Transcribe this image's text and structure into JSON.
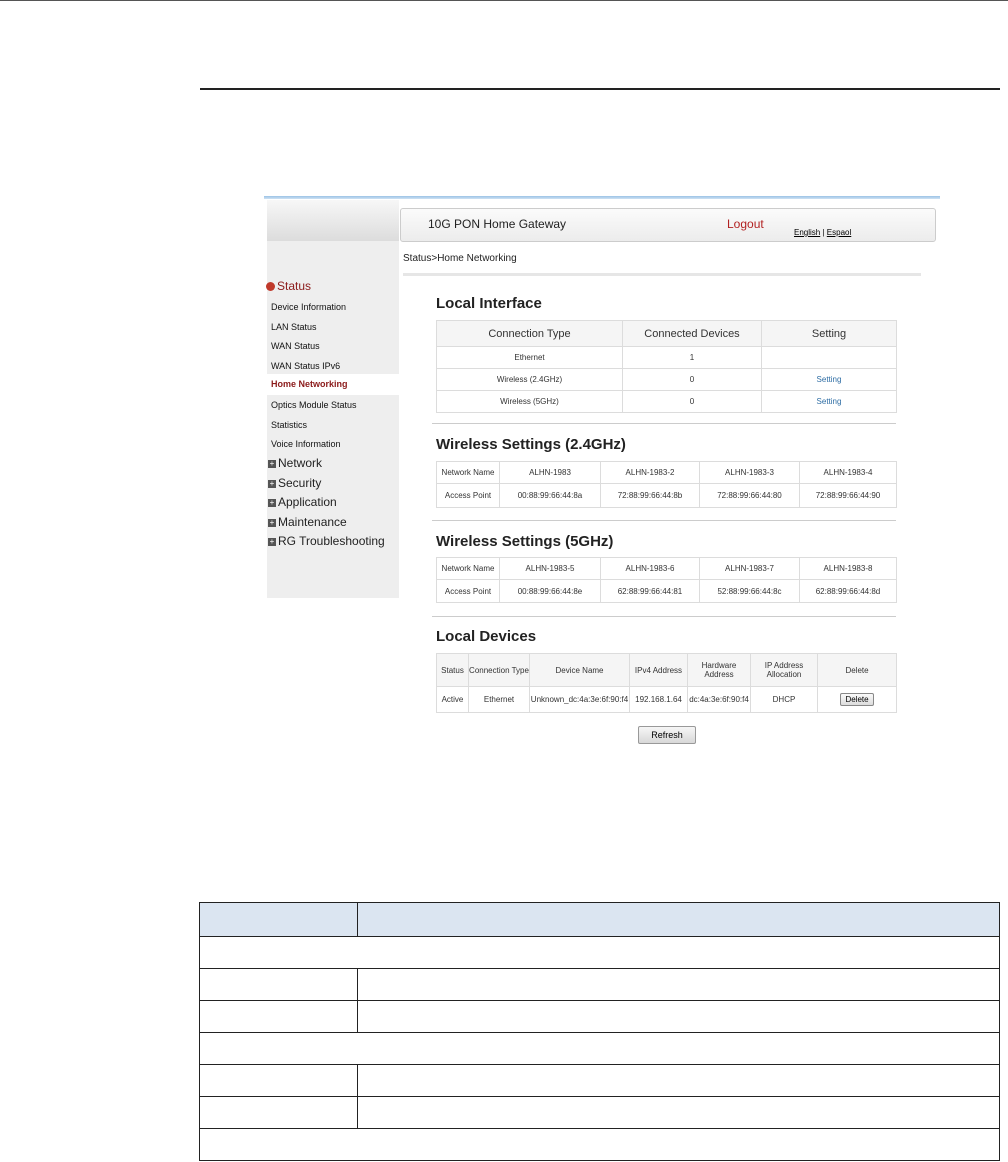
{
  "gateway": {
    "title": "10G PON Home Gateway",
    "logout": "Logout",
    "lang_english": "English",
    "lang_sep": "|",
    "lang_espanol": "Espaol"
  },
  "breadcrumb": "Status>Home Networking",
  "sidebar": {
    "status_label": "Status",
    "items": [
      "Device Information",
      "LAN Status",
      "WAN Status",
      "WAN Status IPv6",
      "Home Networking",
      "Optics Module Status",
      "Statistics",
      "Voice Information"
    ],
    "groups": [
      "Network",
      "Security",
      "Application",
      "Maintenance",
      "RG Troubleshooting"
    ]
  },
  "local_interface": {
    "title": "Local Interface",
    "headers": [
      "Connection Type",
      "Connected Devices",
      "Setting"
    ],
    "rows": [
      {
        "type": "Ethernet",
        "devices": "1",
        "setting": ""
      },
      {
        "type": "Wireless (2.4GHz)",
        "devices": "0",
        "setting": "Setting"
      },
      {
        "type": "Wireless (5GHz)",
        "devices": "0",
        "setting": "Setting"
      }
    ]
  },
  "wireless_24": {
    "title": "Wireless Settings (2.4GHz)",
    "network_label": "Network Name",
    "ap_label": "Access Point",
    "names": [
      "ALHN-1983",
      "ALHN-1983-2",
      "ALHN-1983-3",
      "ALHN-1983-4"
    ],
    "aps": [
      "00:88:99:66:44:8a",
      "72:88:99:66:44:8b",
      "72:88:99:66:44:80",
      "72:88:99:66:44:90"
    ]
  },
  "wireless_5": {
    "title": "Wireless Settings (5GHz)",
    "network_label": "Network Name",
    "ap_label": "Access Point",
    "names": [
      "ALHN-1983-5",
      "ALHN-1983-6",
      "ALHN-1983-7",
      "ALHN-1983-8"
    ],
    "aps": [
      "00:88:99:66:44:8e",
      "62:88:99:66:44:81",
      "52:88:99:66:44:8c",
      "62:88:99:66:44:8d"
    ]
  },
  "local_devices": {
    "title": "Local Devices",
    "headers": [
      "Status",
      "Connection Type",
      "Device Name",
      "IPv4 Address",
      "Hardware Address",
      "IP Address Allocation",
      "Delete"
    ],
    "row": {
      "status": "Active",
      "type": "Ethernet",
      "name": "Unknown_dc:4a:3e:6f:90:f4",
      "ip": "192.168.1.64",
      "mac": "dc:4a:3e:6f:90:f4",
      "alloc": "DHCP",
      "delete": "Delete"
    },
    "refresh": "Refresh"
  }
}
